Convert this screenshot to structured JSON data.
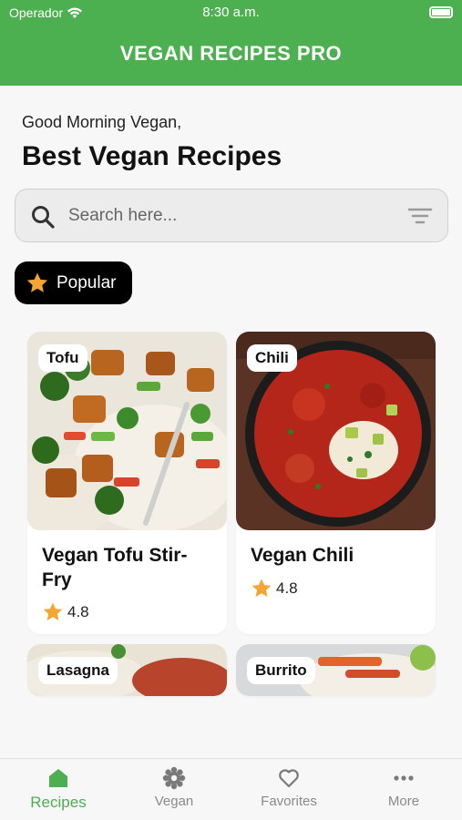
{
  "status_bar": {
    "carrier": "Operador",
    "time": "8:30 a.m."
  },
  "header": {
    "title": "VEGAN RECIPES PRO"
  },
  "greeting": "Good Morning Vegan,",
  "page_title": "Best Vegan Recipes",
  "search": {
    "placeholder": "Search here...",
    "value": ""
  },
  "category_chip": {
    "label": "Popular",
    "icon": "star-icon"
  },
  "recipes": [
    {
      "tag": "Tofu",
      "name": "Vegan Tofu Stir-Fry",
      "rating": "4.8"
    },
    {
      "tag": "Chili",
      "name": "Vegan Chili",
      "rating": "4.8"
    },
    {
      "tag": "Lasagna"
    },
    {
      "tag": "Burrito"
    }
  ],
  "bottom_nav": [
    {
      "label": "Recipes",
      "icon": "home-icon",
      "active": true
    },
    {
      "label": "Vegan",
      "icon": "gear-flower-icon",
      "active": false
    },
    {
      "label": "Favorites",
      "icon": "heart-icon",
      "active": false
    },
    {
      "label": "More",
      "icon": "more-icon",
      "active": false
    }
  ],
  "colors": {
    "primary": "#4caf50",
    "star": "#f4a533",
    "chip_bg": "#000000"
  }
}
